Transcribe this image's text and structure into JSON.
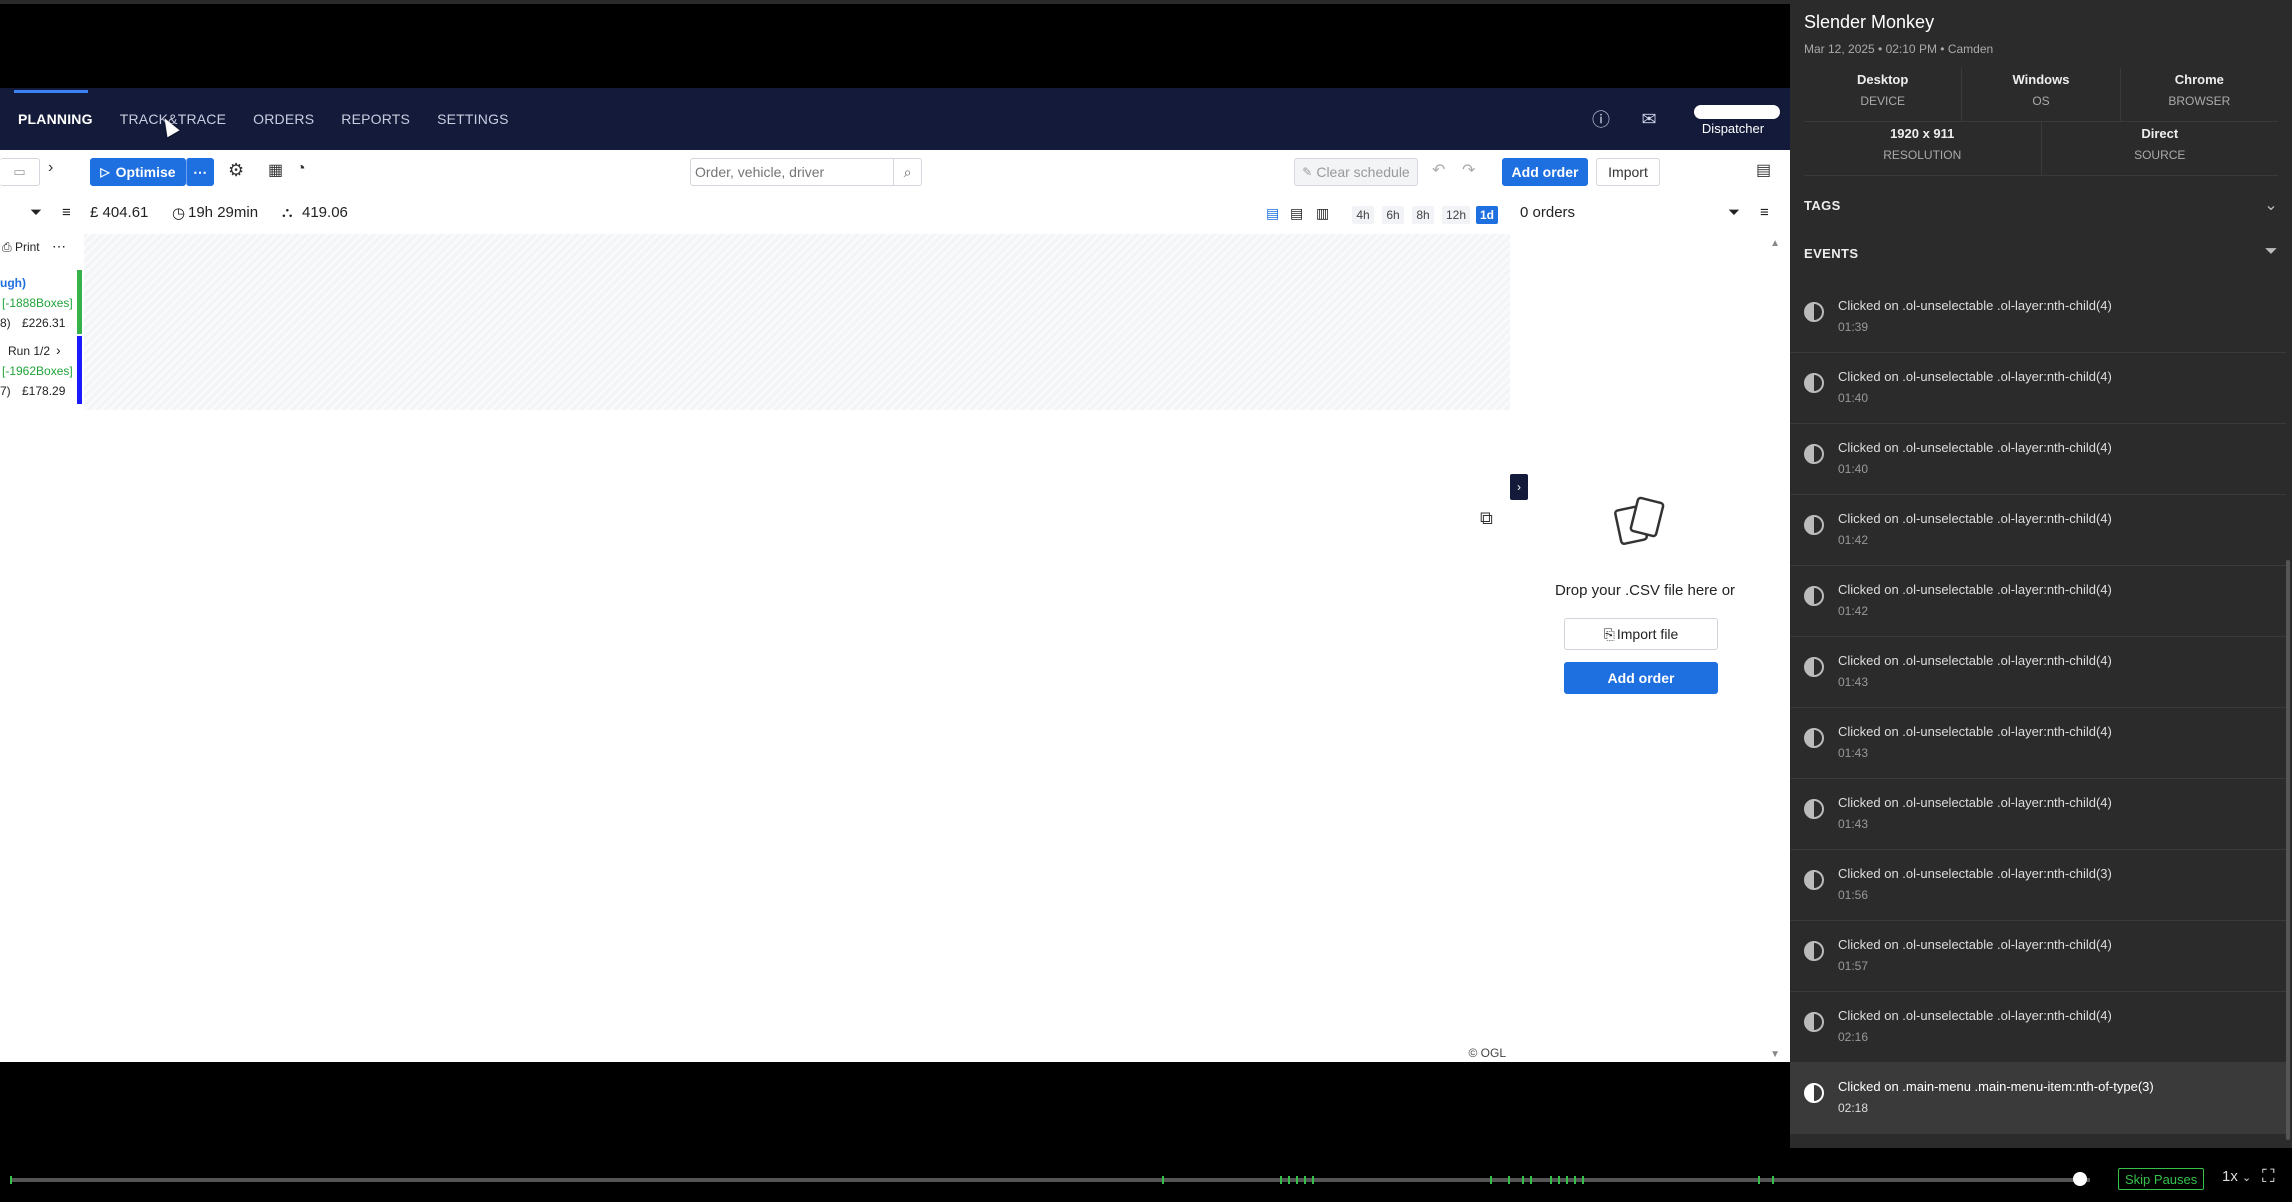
{
  "nav": {
    "items": [
      {
        "label": "PLANNING",
        "active": true
      },
      {
        "label": "TRACK&TRACE",
        "active": false
      },
      {
        "label": "ORDERS",
        "active": false
      },
      {
        "label": "REPORTS",
        "active": false
      },
      {
        "label": "SETTINGS",
        "active": false
      }
    ],
    "help_icon": "question-circle-icon",
    "mail_icon": "mail-icon",
    "user_role": "Dispatcher"
  },
  "toolbar": {
    "optimise_label": "Optimise",
    "more_glyph": "⋯",
    "search_placeholder": "Order, vehicle, driver",
    "clear_schedule_label": "Clear schedule",
    "add_order_label": "Add order",
    "import_label": "Import"
  },
  "stats": {
    "cost": "£ 404.61",
    "duration": "19h 29min",
    "distance": "419.06",
    "zoom_options": [
      "4h",
      "6h",
      "8h",
      "12h",
      "1d"
    ],
    "zoom_selected": "1d",
    "orders_count": "0 orders"
  },
  "runs": {
    "print_label": "Print",
    "run1": {
      "title": "ugh)",
      "boxes": "[-1888Boxes]",
      "count": "8)",
      "cost": "£226.31",
      "color": "#36b24a"
    },
    "run2": {
      "title": "Run 1/2",
      "boxes": "[-1962Boxes]",
      "count": "7)",
      "cost": "£178.29",
      "color": "#1a1aff"
    }
  },
  "map": {
    "copyright": "© OGL"
  },
  "orders_panel": {
    "drop_text": "Drop your .CSV file here or",
    "import_file_label": "Import file",
    "add_order_label": "Add order"
  },
  "session": {
    "title": "Slender Monkey",
    "subtitle": "Mar 12, 2025  •  02:10 PM  •  Camden",
    "meta": [
      {
        "value": "Desktop",
        "key": "DEVICE"
      },
      {
        "value": "Windows",
        "key": "OS"
      },
      {
        "value": "Chrome",
        "key": "BROWSER"
      }
    ],
    "meta2": [
      {
        "value": "1920 x 911",
        "key": "RESOLUTION"
      },
      {
        "value": "Direct",
        "key": "SOURCE"
      }
    ],
    "tags_label": "TAGS",
    "events_label": "EVENTS"
  },
  "events": [
    {
      "text": "Clicked on .ol-unselectable .ol-layer:nth-child(4)",
      "time": "01:39"
    },
    {
      "text": "Clicked on .ol-unselectable .ol-layer:nth-child(4)",
      "time": "01:40"
    },
    {
      "text": "Clicked on .ol-unselectable .ol-layer:nth-child(4)",
      "time": "01:40"
    },
    {
      "text": "Clicked on .ol-unselectable .ol-layer:nth-child(4)",
      "time": "01:42"
    },
    {
      "text": "Clicked on .ol-unselectable .ol-layer:nth-child(4)",
      "time": "01:42"
    },
    {
      "text": "Clicked on .ol-unselectable .ol-layer:nth-child(4)",
      "time": "01:43"
    },
    {
      "text": "Clicked on .ol-unselectable .ol-layer:nth-child(4)",
      "time": "01:43"
    },
    {
      "text": "Clicked on .ol-unselectable .ol-layer:nth-child(4)",
      "time": "01:43"
    },
    {
      "text": "Clicked on .ol-unselectable .ol-layer:nth-child(3)",
      "time": "01:56"
    },
    {
      "text": "Clicked on .ol-unselectable .ol-layer:nth-child(4)",
      "time": "01:57"
    },
    {
      "text": "Clicked on .ol-unselectable .ol-layer:nth-child(4)",
      "time": "02:16"
    },
    {
      "text": "Clicked on .main-menu .main-menu-item:nth-of-type(3)",
      "time": "02:18"
    }
  ],
  "player": {
    "skip_pauses_label": "Skip Pauses",
    "speed_label": "1x",
    "progress_fraction": 0.995,
    "accent": "#36c24a"
  }
}
